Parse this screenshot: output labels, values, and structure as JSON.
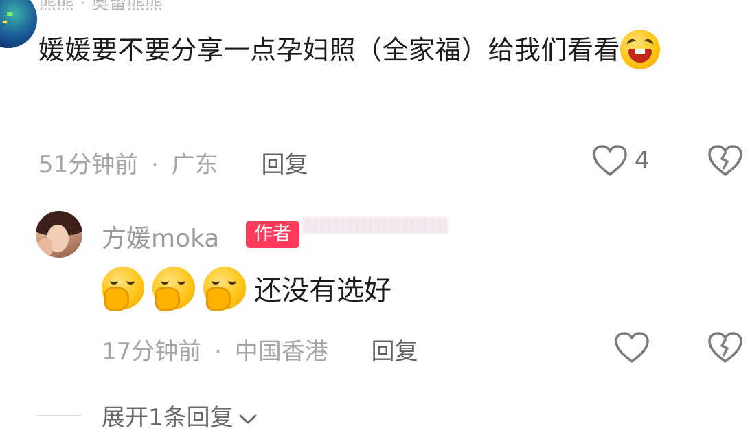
{
  "parent_comment": {
    "header_fragment": "熊熊 · 奥留熊熊",
    "text": "媛媛要不要分享一点孕妇照（全家福）给我们看看",
    "emoji": "laughing-emoji",
    "time": "51分钟前",
    "separator": "·",
    "location": "广东",
    "reply_label": "回复",
    "like_count": "4"
  },
  "reply_comment": {
    "author": "方媛moka",
    "badge": "作者",
    "emojis": [
      "face-with-hand-over-mouth-emoji",
      "face-with-hand-over-mouth-emoji",
      "face-with-hand-over-mouth-emoji"
    ],
    "text": "还没有选好",
    "time": "17分钟前",
    "separator": "·",
    "location": "中国香港",
    "reply_label": "回复"
  },
  "expand": {
    "label": "展开1条回复"
  },
  "colors": {
    "badge": "#ff3b5c",
    "meta_text": "#a6a6a6",
    "body_text": "#1b1b1b"
  }
}
